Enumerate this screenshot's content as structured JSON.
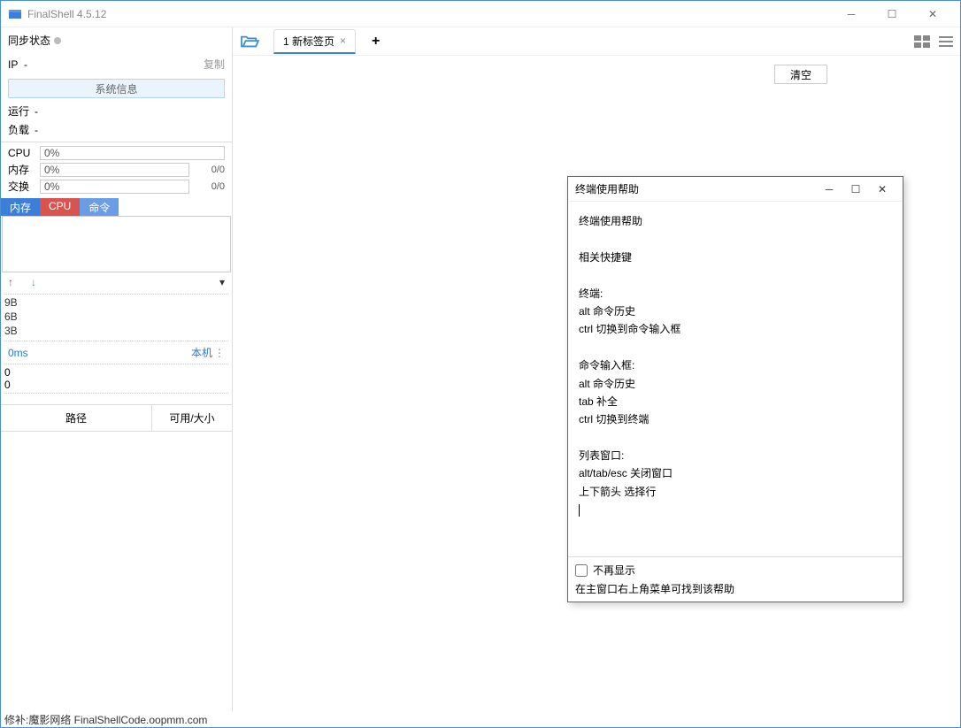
{
  "app": {
    "title": "FinalShell 4.5.12"
  },
  "sidebar": {
    "sync_status_label": "同步状态",
    "ip_label": "IP",
    "ip_value": "-",
    "copy_label": "复制",
    "sysinfo_button": "系统信息",
    "running_label": "运行",
    "running_value": "-",
    "load_label": "负载",
    "load_value": "-",
    "cpu_label": "CPU",
    "cpu_value": "0%",
    "mem_label": "内存",
    "mem_value": "0%",
    "mem_numbers": "0/0",
    "swap_label": "交换",
    "swap_value": "0%",
    "swap_numbers": "0/0",
    "tabs": {
      "mem": "内存",
      "cpu": "CPU",
      "cmd": "命令"
    },
    "net_labels": [
      "9B",
      "6B",
      "3B"
    ],
    "ping_ms": "0ms",
    "ping_host": "本机",
    "ping_zero1": "0",
    "ping_zero2": "0",
    "disk_header_path": "路径",
    "disk_header_size": "可用/大小"
  },
  "toolbar": {
    "tab_label": "1 新标签页"
  },
  "buttons": {
    "clear": "清空"
  },
  "modal": {
    "title": "终端使用帮助",
    "content": [
      "终端使用帮助",
      "",
      "相关快捷键",
      "",
      "终端:",
      "alt 命令历史",
      "ctrl 切换到命令输入框",
      "",
      "命令输入框:",
      "alt 命令历史",
      "tab 补全",
      "ctrl 切换到终端",
      "",
      "列表窗口:",
      "alt/tab/esc 关闭窗口",
      "上下箭头 选择行"
    ],
    "no_show": "不再显示",
    "footer_note": "在主窗口右上角菜单可找到该帮助"
  },
  "footer": {
    "text": "修补:魔影网络 FinalShellCode.oopmm.com"
  }
}
